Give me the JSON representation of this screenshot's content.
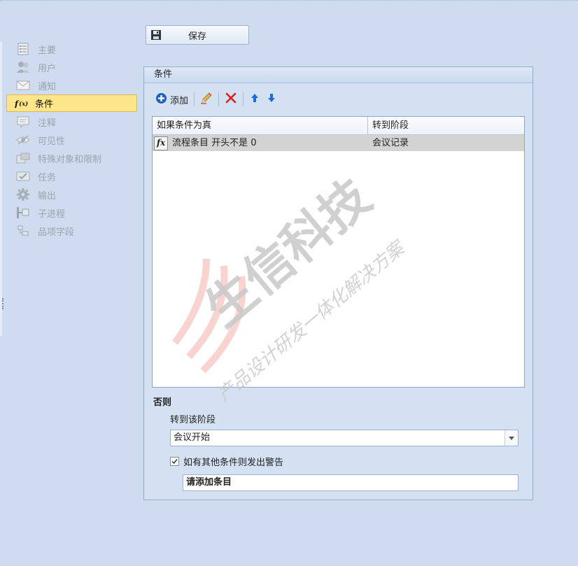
{
  "sidebar": {
    "items": [
      {
        "label": "主要",
        "icon": "list-icon"
      },
      {
        "label": "用户",
        "icon": "users-icon"
      },
      {
        "label": "通知",
        "icon": "envelope-icon"
      },
      {
        "label": "条件",
        "icon": "function-icon",
        "active": true
      },
      {
        "label": "注释",
        "icon": "comment-icon"
      },
      {
        "label": "可见性",
        "icon": "eye-icon"
      },
      {
        "label": "特殊对象和限制",
        "icon": "objects-icon"
      },
      {
        "label": "任务",
        "icon": "task-icon"
      },
      {
        "label": "输出",
        "icon": "gear-icon"
      },
      {
        "label": "子进程",
        "icon": "subprocess-icon"
      },
      {
        "label": "品项字段",
        "icon": "fields-icon"
      }
    ]
  },
  "toolbar": {
    "save_label": "保存"
  },
  "panel": {
    "title": "条件",
    "actions": {
      "add_label": "添加"
    },
    "grid": {
      "headers": [
        "如果条件为真",
        "转到阶段"
      ],
      "rows": [
        {
          "condition": "流程条目 开头不是 0",
          "stage": "会议记录"
        }
      ]
    },
    "else": {
      "title": "否则",
      "goto_label": "转到该阶段",
      "selected_stage": "会议开始",
      "warn_label": "如有其他条件则发出警告",
      "warn_checked": true,
      "message": "请添加条目"
    }
  },
  "watermark": {
    "title": "生信科技",
    "slogan": "产品设计研发一体化解决方案"
  },
  "colors": {
    "background": "#cfdcef",
    "active_item": "#fde58a",
    "delete_red": "#d62020",
    "arrow_blue": "#1a6fd1"
  }
}
